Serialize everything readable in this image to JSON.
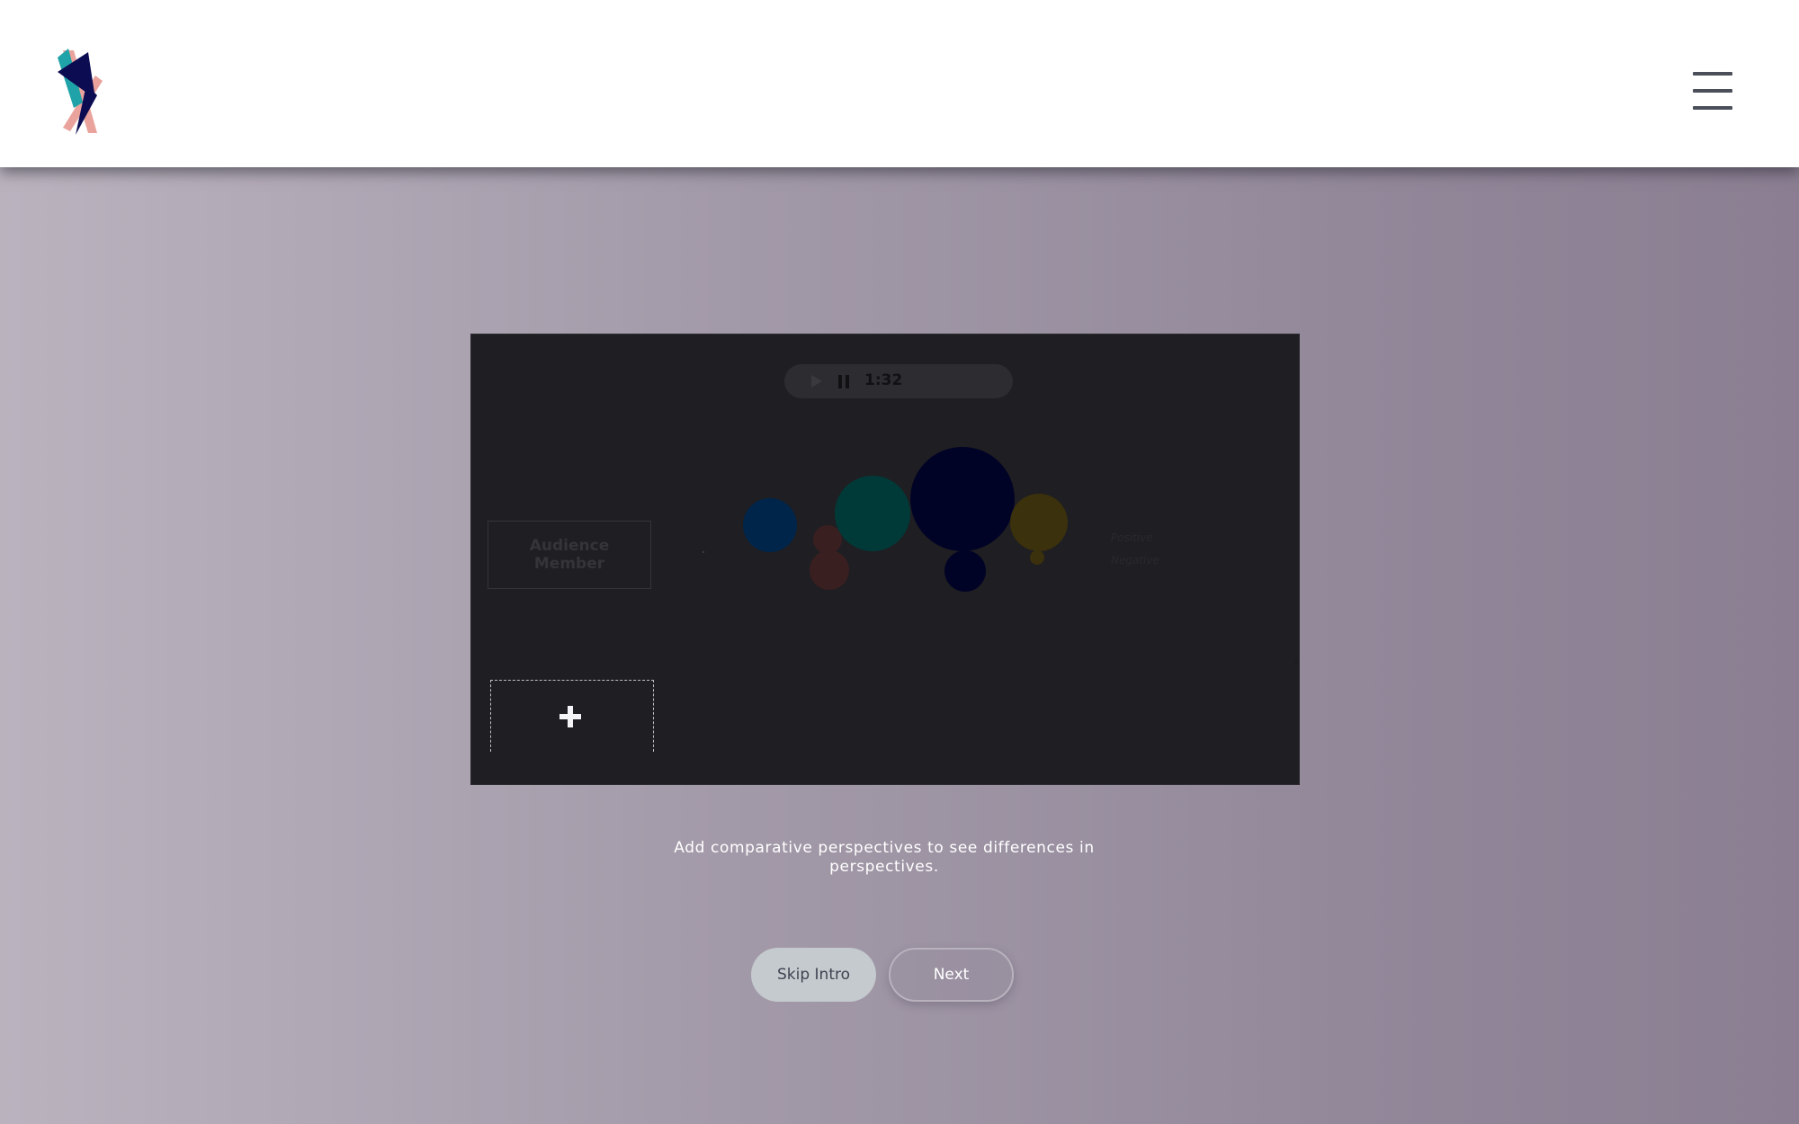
{
  "header": {
    "logo_icon": "brand-logo-icon",
    "menu_icon": "hamburger-menu-icon"
  },
  "player": {
    "play_icon": "play-icon",
    "pause_icon": "pause-icon",
    "time": "1:32"
  },
  "visualization": {
    "audience_label": "Audience Member",
    "legend": {
      "positive": "Positive",
      "negative": "Negative"
    },
    "add_perspective_icon": "plus-icon",
    "bubble_colors": [
      "#00254a",
      "#003a38",
      "#010326",
      "#3b310c",
      "#3a1f21"
    ]
  },
  "caption": "Add comparative perspectives to see differences in perspectives.",
  "buttons": {
    "skip_label": "Skip Intro",
    "next_label": "Next"
  },
  "colors": {
    "header_bg": "#ffffff",
    "stage_bg": "#1f1e22",
    "skip_bg": "#c4cacd",
    "accent_teal": "#1fa3a8",
    "accent_navy": "#0c0c52",
    "accent_pink": "#e9a39c"
  }
}
